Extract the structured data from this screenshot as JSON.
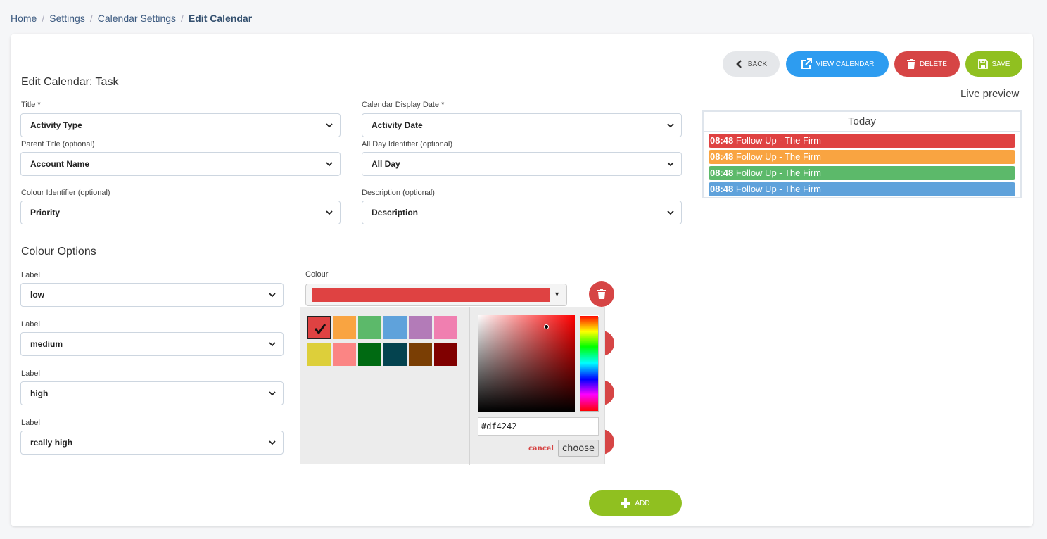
{
  "breadcrumb": [
    "Home",
    "Settings",
    "Calendar Settings",
    "Edit Calendar"
  ],
  "page_title": "Edit Calendar: Task",
  "toolbar": {
    "back": "Back",
    "view_calendar": "View Calendar",
    "delete": "Delete",
    "save": "Save"
  },
  "form": {
    "title_label": "Title *",
    "title_value": "Activity Type",
    "display_date_label": "Calendar Display Date *",
    "display_date_value": "Activity Date",
    "parent_title_label": "Parent Title (optional)",
    "parent_title_value": "Account Name",
    "all_day_label": "All Day Identifier (optional)",
    "all_day_value": "All Day",
    "colour_identifier_label": "Colour Identifier (optional)",
    "colour_identifier_value": "Priority",
    "description_label": "Description (optional)",
    "description_value": "Description"
  },
  "colour_options": {
    "title": "Colour Options",
    "colour_label": "Colour",
    "rows": [
      {
        "label": "Label",
        "value": "low"
      },
      {
        "label": "Label",
        "value": "medium"
      },
      {
        "label": "Label",
        "value": "high"
      },
      {
        "label": "Label",
        "value": "really high"
      }
    ],
    "selected_colour": "#df4242",
    "add_label": "Add"
  },
  "picker": {
    "palette": [
      "#df4242",
      "#f9a441",
      "#5cb96a",
      "#5fa2db",
      "#b37bb8",
      "#f07fb0",
      "#ddcf3a",
      "#fb8584",
      "#006a12",
      "#04434f",
      "#7a3e04",
      "#800000"
    ],
    "hex_value": "#df4242",
    "cancel": "cancel",
    "choose": "choose"
  },
  "preview": {
    "label": "Live preview",
    "header": "Today",
    "events": [
      {
        "time": "08:48",
        "text": "Follow Up - The Firm",
        "color": "#df4242"
      },
      {
        "time": "08:48",
        "text": "Follow Up - The Firm",
        "color": "#f9a441"
      },
      {
        "time": "08:48",
        "text": "Follow Up - The Firm",
        "color": "#5cb96a"
      },
      {
        "time": "08:48",
        "text": "Follow Up - The Firm",
        "color": "#5fa2db"
      }
    ]
  }
}
